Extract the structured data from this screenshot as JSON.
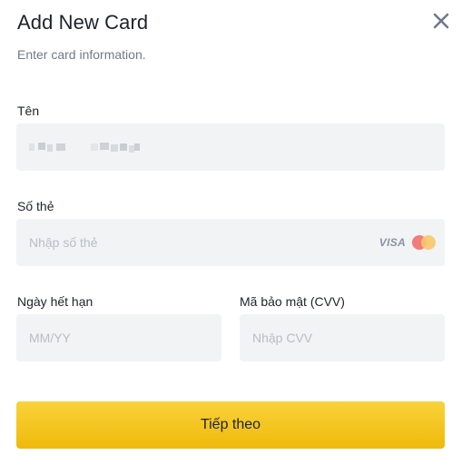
{
  "dialog": {
    "title": "Add New Card",
    "subtitle": "Enter card information.",
    "close_icon": "close-icon"
  },
  "form": {
    "name": {
      "label": "Tên",
      "value": ""
    },
    "card_number": {
      "label": "Số thẻ",
      "placeholder": "Nhập số thẻ",
      "brand_visa": "VISA",
      "brand_mastercard_icon": "mastercard-icon"
    },
    "expiry": {
      "label": "Ngày hết hạn",
      "placeholder": "MM/YY"
    },
    "cvv": {
      "label": "Mã bảo mật (CVV)",
      "placeholder": "Nhập CVV"
    }
  },
  "submit": {
    "label": "Tiếp theo"
  },
  "colors": {
    "accent": "#f0b90b",
    "field_bg": "#f2f3f5",
    "text": "#1e2329",
    "muted": "#707a8a"
  }
}
